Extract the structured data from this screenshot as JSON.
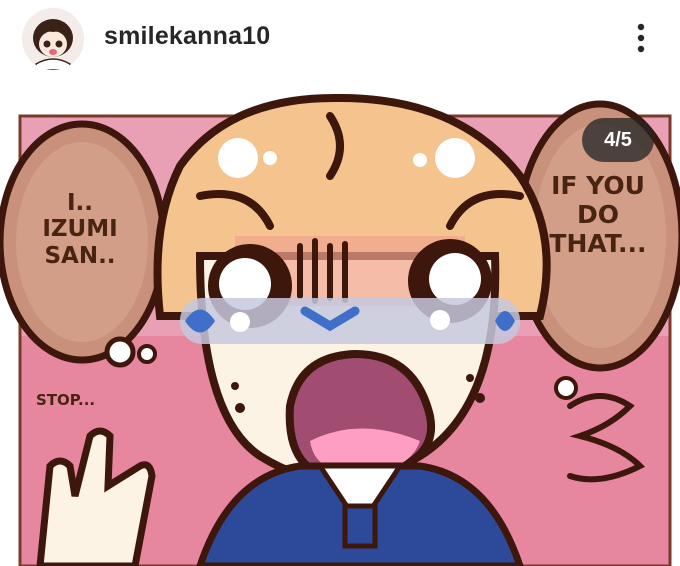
{
  "header": {
    "username": "smilekanna10",
    "avatar_icon": "profile-avatar",
    "more_icon": "more-vertical-icon"
  },
  "post": {
    "slide_counter": "4/5",
    "current_slide": 4,
    "total_slides": 5,
    "bubble_left": [
      "I..",
      "IZUMI",
      "SAN.."
    ],
    "bubble_right": [
      "IF YOU",
      "DO",
      "THAT..."
    ],
    "caption_small": "STOP..."
  },
  "colors": {
    "outline": "#3d160c",
    "hair": "#f5c48e",
    "skin": "#fdf3e4",
    "background_pink": "#e88aa5",
    "uniform": "#2d4a9a",
    "tears": "#3f6fc9",
    "mouth": "#a14d72"
  }
}
